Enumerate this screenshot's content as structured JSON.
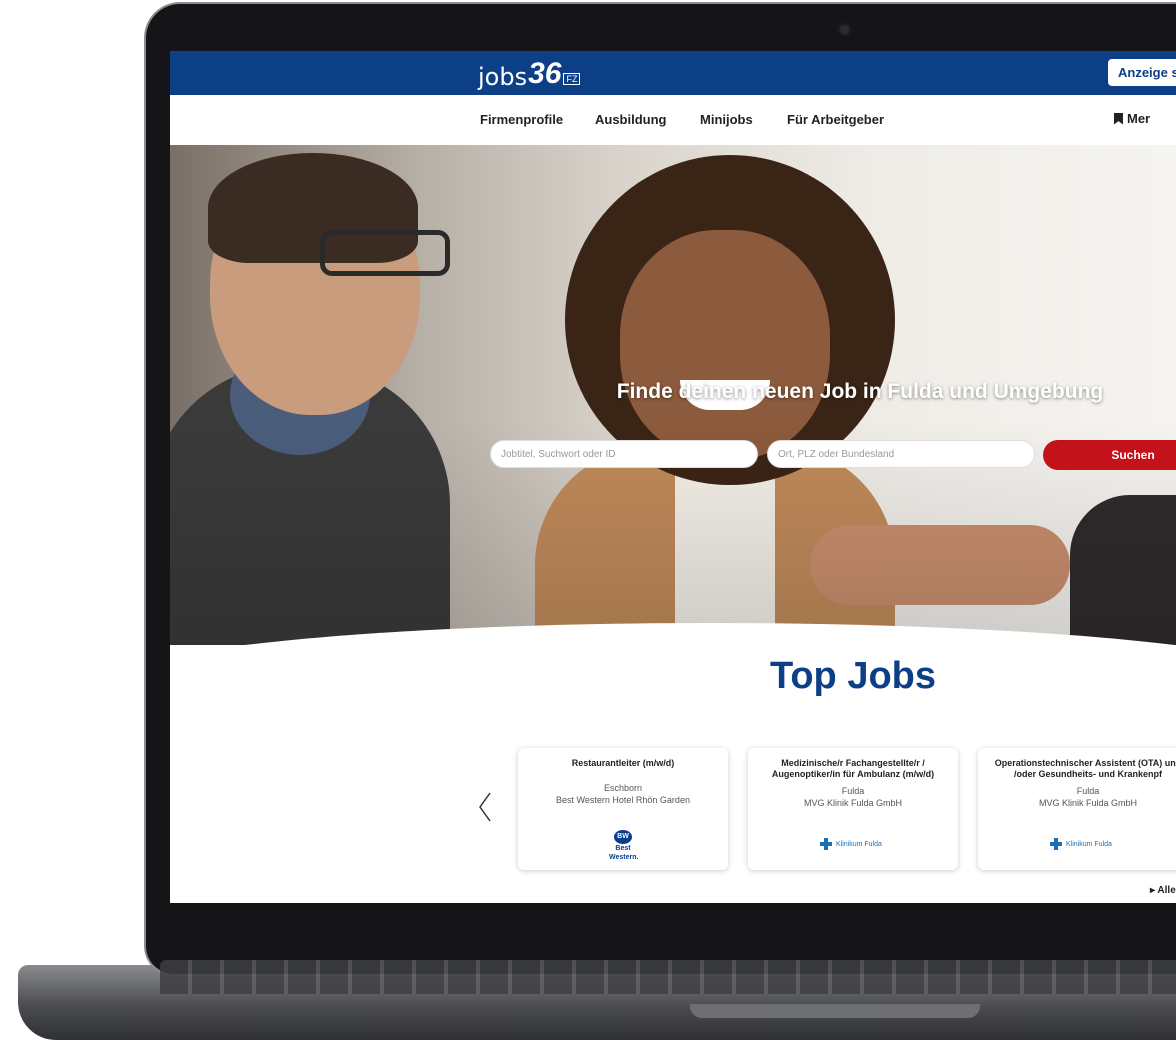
{
  "header": {
    "logo_text": "jobs",
    "logo_number": "36",
    "logo_badge": "FZ",
    "post_ad_label": "Anzeige s"
  },
  "nav": {
    "items": [
      "Firmenprofile",
      "Ausbildung",
      "Minijobs",
      "Für Arbeitgeber"
    ],
    "bookmark_label": "Mer"
  },
  "hero": {
    "title": "Finde deinen neuen Job in Fulda und Umgebung",
    "search": {
      "keyword_placeholder": "Jobtitel, Suchwort oder ID",
      "location_placeholder": "Ort, PLZ oder Bundesland",
      "button_label": "Suchen"
    }
  },
  "top_jobs": {
    "title": "Top Jobs",
    "prev_icon": "chevron-left-icon",
    "cards": [
      {
        "title": "Restaurantleiter (m/w/d)",
        "location": "Eschborn",
        "company": "Best Western Hotel Rhön Garden",
        "logo": {
          "icon": "BW",
          "text_line1": "Best",
          "text_line2": "Western."
        }
      },
      {
        "title": "Medizinische/r Fachangestellte/r / Augenoptiker/in für Ambulanz (m/w/d)",
        "location": "Fulda",
        "company": "MVG Klinik Fulda GmbH",
        "logo": {
          "text": "Klinikum Fulda"
        }
      },
      {
        "title": "Operationstechnischer Assistent (OTA) und /oder Gesundheits- und Krankenpf",
        "location": "Fulda",
        "company": "MVG Klinik Fulda GmbH",
        "logo": {
          "text": "Klinikum Fulda"
        }
      }
    ],
    "all_link": "▸ Alle"
  },
  "colors": {
    "brand_blue": "#0d3f87",
    "search_red": "#c4121a"
  }
}
